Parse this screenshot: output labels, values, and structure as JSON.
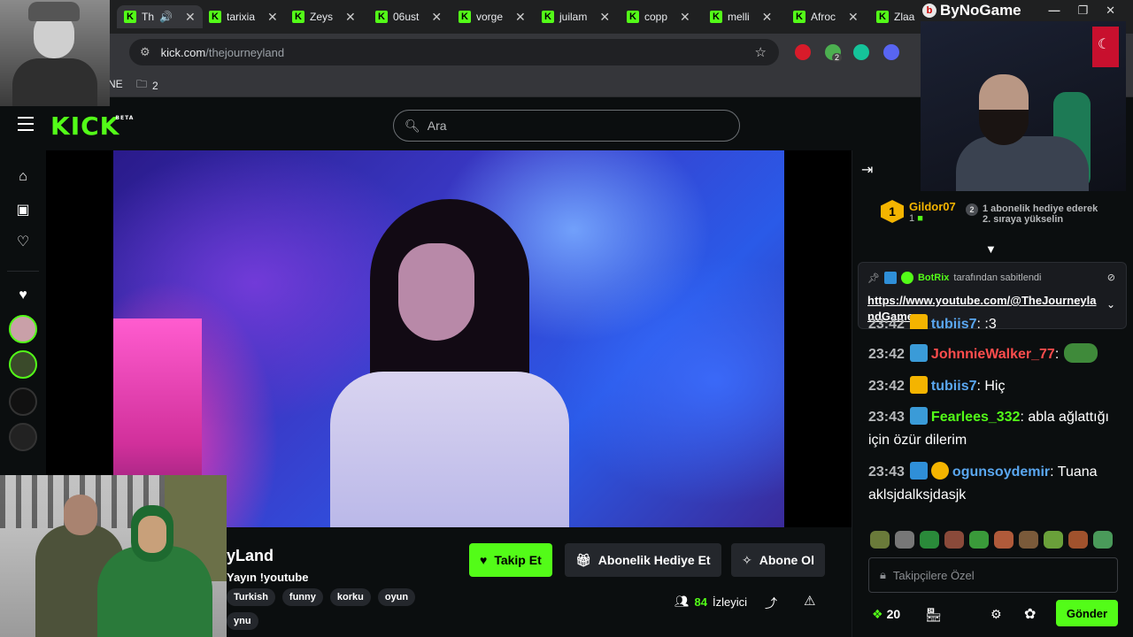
{
  "browser": {
    "tabs": [
      {
        "title": "Th",
        "active": true
      },
      {
        "title": "tarixia"
      },
      {
        "title": "Zeys"
      },
      {
        "title": "06ust"
      },
      {
        "title": "vorge"
      },
      {
        "title": "juilam"
      },
      {
        "title": "copp"
      },
      {
        "title": "melli"
      },
      {
        "title": "Afroc"
      },
      {
        "title": "Zlaa"
      }
    ],
    "url_host": "kick.com",
    "url_path": "/thejourneyland",
    "bookmarks": {
      "item1": "NE",
      "folder_count": "2"
    },
    "extension_badge": "2"
  },
  "overlay_brand": "ByNoGame",
  "kick": {
    "logo": "KICK",
    "logo_badge": "BETA",
    "search_placeholder": "Ara"
  },
  "stream": {
    "title": "yLand",
    "subtitle": "Yayın !youtube",
    "tags": [
      "Turkish",
      "funny",
      "korku",
      "oyun"
    ],
    "tag_overflow": "ynu",
    "follow_label": "Takip Et",
    "gift_label": "Abonelik Hediye Et",
    "subscribe_label": "Abone Ol",
    "viewer_count": "84",
    "viewer_label": "İzleyici"
  },
  "chat": {
    "leader": {
      "rank": "1",
      "name": "Gildor07",
      "count": "1"
    },
    "leader_goal": {
      "rank": "2",
      "line1": "1 abonelik hediye ederek",
      "line2": "2. sıraya yükselin"
    },
    "pinned": {
      "by_user": "BotRix",
      "by_text": "tarafından sabitlendi",
      "link": "https://www.youtube.com/@TheJourneylandGames"
    },
    "messages": [
      {
        "time": "23:42",
        "user": "tubiis7",
        "text": ": :3",
        "color": "#5aa7f0",
        "badge": "#f4b400"
      },
      {
        "time": "23:42",
        "user": "JohnnieWalker_77",
        "text": ":",
        "color": "#ff4d4d",
        "badge": "#3a9bd8"
      },
      {
        "time": "23:42",
        "user": "tubiis7",
        "text": ": Hiç",
        "color": "#5aa7f0",
        "badge": "#f4b400"
      },
      {
        "time": "23:43",
        "user": "Fearlees_332",
        "text": ": abla ağlattığı için özür dilerim",
        "color": "#53fc18",
        "badge": "#3a9bd8"
      },
      {
        "time": "23:43",
        "user": "ogunsoydemir",
        "text": ": Tuana aklsjdalksjdasjk",
        "color": "#5aa7f0",
        "badge": "#2f8fd8"
      }
    ],
    "input_placeholder": "Takipçilere Özel",
    "points": "20",
    "send_label": "Gönder"
  },
  "colors": {
    "kick_green": "#53fc18",
    "bg": "#0b0e0f",
    "panel": "#24272c"
  }
}
